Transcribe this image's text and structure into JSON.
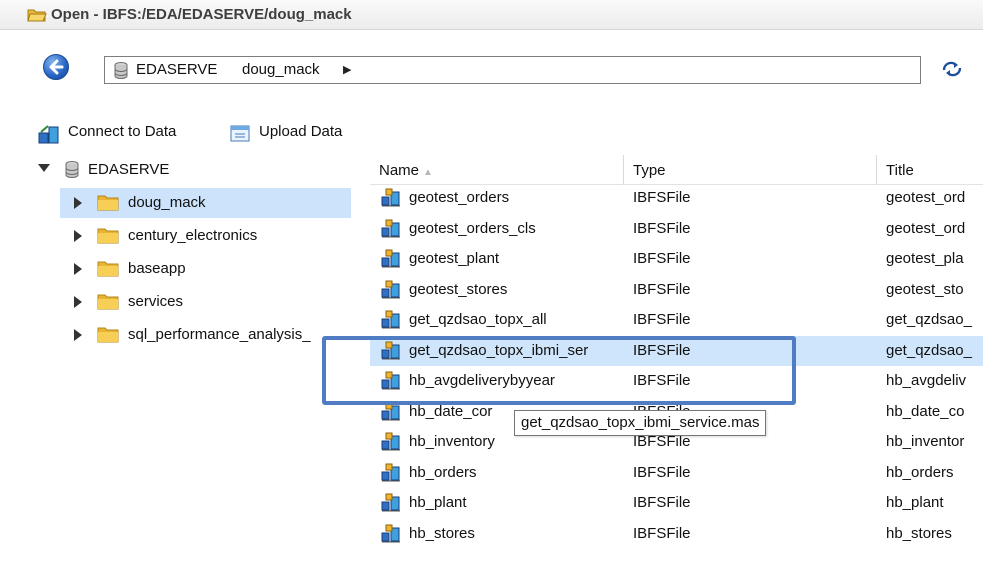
{
  "window": {
    "title": "Open - IBFS:/EDA/EDASERVE/doug_mack"
  },
  "path": {
    "crumbs": [
      "EDASERVE",
      "doug_mack"
    ]
  },
  "actions": {
    "connect": "Connect to Data",
    "upload": "Upload Data"
  },
  "tree": {
    "root": "EDASERVE",
    "children": [
      "doug_mack",
      "century_electronics",
      "baseapp",
      "services",
      "sql_performance_analysis_"
    ]
  },
  "columns": {
    "name": "Name",
    "type": "Type",
    "title": "Title"
  },
  "files": [
    {
      "name": "geotest_orders",
      "type": "IBFSFile",
      "title": "geotest_ord"
    },
    {
      "name": "geotest_orders_cls",
      "type": "IBFSFile",
      "title": "geotest_ord"
    },
    {
      "name": "geotest_plant",
      "type": "IBFSFile",
      "title": "geotest_pla"
    },
    {
      "name": "geotest_stores",
      "type": "IBFSFile",
      "title": "geotest_sto"
    },
    {
      "name": "get_qzdsao_topx_all",
      "type": "IBFSFile",
      "title": "get_qzdsao_"
    },
    {
      "name": "get_qzdsao_topx_ibmi_ser",
      "type": "IBFSFile",
      "title": "get_qzdsao_"
    },
    {
      "name": "hb_avgdeliverybyyear",
      "type": "IBFSFile",
      "title": "hb_avgdeliv"
    },
    {
      "name": "hb_date_cor",
      "type": "IBFSFile",
      "title": "hb_date_co"
    },
    {
      "name": "hb_inventory",
      "type": "IBFSFile",
      "title": "hb_inventor"
    },
    {
      "name": "hb_orders",
      "type": "IBFSFile",
      "title": "hb_orders"
    },
    {
      "name": "hb_plant",
      "type": "IBFSFile",
      "title": "hb_plant"
    },
    {
      "name": "hb_stores",
      "type": "IBFSFile",
      "title": "hb_stores"
    }
  ],
  "tooltip": "get_qzdsao_topx_ibmi_service.mas",
  "colors": {
    "selection": "#cfe5fb",
    "highlight_border": "#4f7cc3",
    "folder": "#f5c542"
  }
}
